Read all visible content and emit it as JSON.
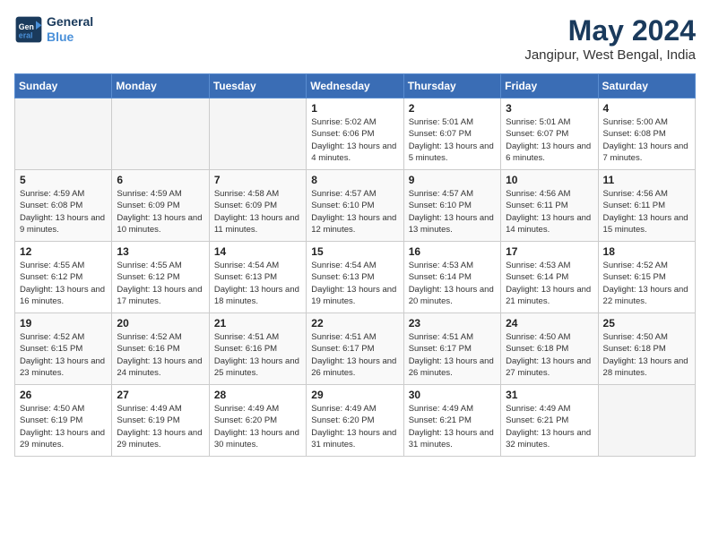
{
  "header": {
    "logo_line1": "General",
    "logo_line2": "Blue",
    "month": "May 2024",
    "location": "Jangipur, West Bengal, India"
  },
  "weekdays": [
    "Sunday",
    "Monday",
    "Tuesday",
    "Wednesday",
    "Thursday",
    "Friday",
    "Saturday"
  ],
  "weeks": [
    [
      {
        "day": "",
        "empty": true
      },
      {
        "day": "",
        "empty": true
      },
      {
        "day": "",
        "empty": true
      },
      {
        "day": "1",
        "sunrise": "5:02 AM",
        "sunset": "6:06 PM",
        "daylight": "13 hours and 4 minutes."
      },
      {
        "day": "2",
        "sunrise": "5:01 AM",
        "sunset": "6:07 PM",
        "daylight": "13 hours and 5 minutes."
      },
      {
        "day": "3",
        "sunrise": "5:01 AM",
        "sunset": "6:07 PM",
        "daylight": "13 hours and 6 minutes."
      },
      {
        "day": "4",
        "sunrise": "5:00 AM",
        "sunset": "6:08 PM",
        "daylight": "13 hours and 7 minutes."
      }
    ],
    [
      {
        "day": "5",
        "sunrise": "4:59 AM",
        "sunset": "6:08 PM",
        "daylight": "13 hours and 9 minutes."
      },
      {
        "day": "6",
        "sunrise": "4:59 AM",
        "sunset": "6:09 PM",
        "daylight": "13 hours and 10 minutes."
      },
      {
        "day": "7",
        "sunrise": "4:58 AM",
        "sunset": "6:09 PM",
        "daylight": "13 hours and 11 minutes."
      },
      {
        "day": "8",
        "sunrise": "4:57 AM",
        "sunset": "6:10 PM",
        "daylight": "13 hours and 12 minutes."
      },
      {
        "day": "9",
        "sunrise": "4:57 AM",
        "sunset": "6:10 PM",
        "daylight": "13 hours and 13 minutes."
      },
      {
        "day": "10",
        "sunrise": "4:56 AM",
        "sunset": "6:11 PM",
        "daylight": "13 hours and 14 minutes."
      },
      {
        "day": "11",
        "sunrise": "4:56 AM",
        "sunset": "6:11 PM",
        "daylight": "13 hours and 15 minutes."
      }
    ],
    [
      {
        "day": "12",
        "sunrise": "4:55 AM",
        "sunset": "6:12 PM",
        "daylight": "13 hours and 16 minutes."
      },
      {
        "day": "13",
        "sunrise": "4:55 AM",
        "sunset": "6:12 PM",
        "daylight": "13 hours and 17 minutes."
      },
      {
        "day": "14",
        "sunrise": "4:54 AM",
        "sunset": "6:13 PM",
        "daylight": "13 hours and 18 minutes."
      },
      {
        "day": "15",
        "sunrise": "4:54 AM",
        "sunset": "6:13 PM",
        "daylight": "13 hours and 19 minutes."
      },
      {
        "day": "16",
        "sunrise": "4:53 AM",
        "sunset": "6:14 PM",
        "daylight": "13 hours and 20 minutes."
      },
      {
        "day": "17",
        "sunrise": "4:53 AM",
        "sunset": "6:14 PM",
        "daylight": "13 hours and 21 minutes."
      },
      {
        "day": "18",
        "sunrise": "4:52 AM",
        "sunset": "6:15 PM",
        "daylight": "13 hours and 22 minutes."
      }
    ],
    [
      {
        "day": "19",
        "sunrise": "4:52 AM",
        "sunset": "6:15 PM",
        "daylight": "13 hours and 23 minutes."
      },
      {
        "day": "20",
        "sunrise": "4:52 AM",
        "sunset": "6:16 PM",
        "daylight": "13 hours and 24 minutes."
      },
      {
        "day": "21",
        "sunrise": "4:51 AM",
        "sunset": "6:16 PM",
        "daylight": "13 hours and 25 minutes."
      },
      {
        "day": "22",
        "sunrise": "4:51 AM",
        "sunset": "6:17 PM",
        "daylight": "13 hours and 26 minutes."
      },
      {
        "day": "23",
        "sunrise": "4:51 AM",
        "sunset": "6:17 PM",
        "daylight": "13 hours and 26 minutes."
      },
      {
        "day": "24",
        "sunrise": "4:50 AM",
        "sunset": "6:18 PM",
        "daylight": "13 hours and 27 minutes."
      },
      {
        "day": "25",
        "sunrise": "4:50 AM",
        "sunset": "6:18 PM",
        "daylight": "13 hours and 28 minutes."
      }
    ],
    [
      {
        "day": "26",
        "sunrise": "4:50 AM",
        "sunset": "6:19 PM",
        "daylight": "13 hours and 29 minutes."
      },
      {
        "day": "27",
        "sunrise": "4:49 AM",
        "sunset": "6:19 PM",
        "daylight": "13 hours and 29 minutes."
      },
      {
        "day": "28",
        "sunrise": "4:49 AM",
        "sunset": "6:20 PM",
        "daylight": "13 hours and 30 minutes."
      },
      {
        "day": "29",
        "sunrise": "4:49 AM",
        "sunset": "6:20 PM",
        "daylight": "13 hours and 31 minutes."
      },
      {
        "day": "30",
        "sunrise": "4:49 AM",
        "sunset": "6:21 PM",
        "daylight": "13 hours and 31 minutes."
      },
      {
        "day": "31",
        "sunrise": "4:49 AM",
        "sunset": "6:21 PM",
        "daylight": "13 hours and 32 minutes."
      },
      {
        "day": "",
        "empty": true
      }
    ]
  ]
}
